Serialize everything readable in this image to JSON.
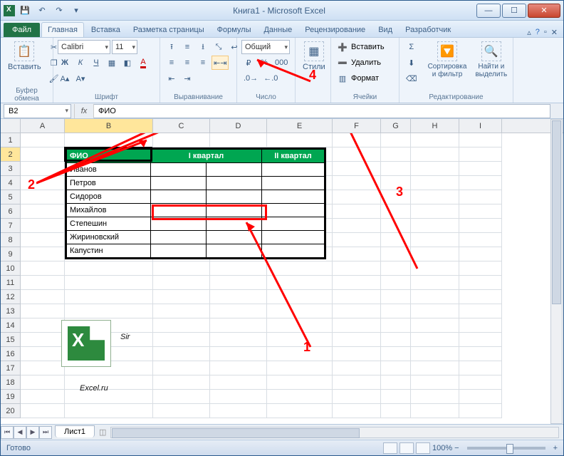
{
  "title": "Книга1  -  Microsoft Excel",
  "qat": {
    "save": "💾",
    "undo": "↶",
    "redo": "↷"
  },
  "tabs": {
    "file": "Файл",
    "home": "Главная",
    "insert": "Вставка",
    "pageLayout": "Разметка страницы",
    "formulas": "Формулы",
    "data": "Данные",
    "review": "Рецензирование",
    "view": "Вид",
    "developer": "Разработчик"
  },
  "ribbon": {
    "clipboard": {
      "paste": "Вставить",
      "label": "Буфер обмена"
    },
    "font": {
      "name": "Calibri",
      "size": "11",
      "bold": "Ж",
      "italic": "К",
      "underline": "Ч",
      "label": "Шрифт"
    },
    "alignment": {
      "label": "Выравнивание"
    },
    "number": {
      "format": "Общий",
      "label": "Число"
    },
    "styles": {
      "styles": "Стили",
      "label": ""
    },
    "cells": {
      "insert": "Вставить",
      "delete": "Удалить",
      "format": "Формат",
      "label": "Ячейки"
    },
    "editing": {
      "sort": "Сортировка и фильтр",
      "find": "Найти и выделить",
      "label": "Редактирование"
    }
  },
  "nameBox": "B2",
  "formula": "ФИО",
  "columns": [
    "A",
    "B",
    "C",
    "D",
    "E",
    "F",
    "G",
    "H",
    "I"
  ],
  "rowCount": 20,
  "table": {
    "headers": [
      "ФИО",
      "I квартал",
      "II квартал"
    ],
    "rows": [
      "Иванов",
      "Петров",
      "Сидоров",
      "Михайлов",
      "Степешин",
      "Жириновский",
      "Капустин"
    ]
  },
  "annotations": {
    "a1": "1",
    "a2": "2",
    "a3": "3",
    "a4": "4"
  },
  "logo": {
    "line1": "Sir",
    "line2": "Excel.ru"
  },
  "sheet": "Лист1",
  "status": "Готово",
  "zoom": "100%",
  "chart_data": null
}
